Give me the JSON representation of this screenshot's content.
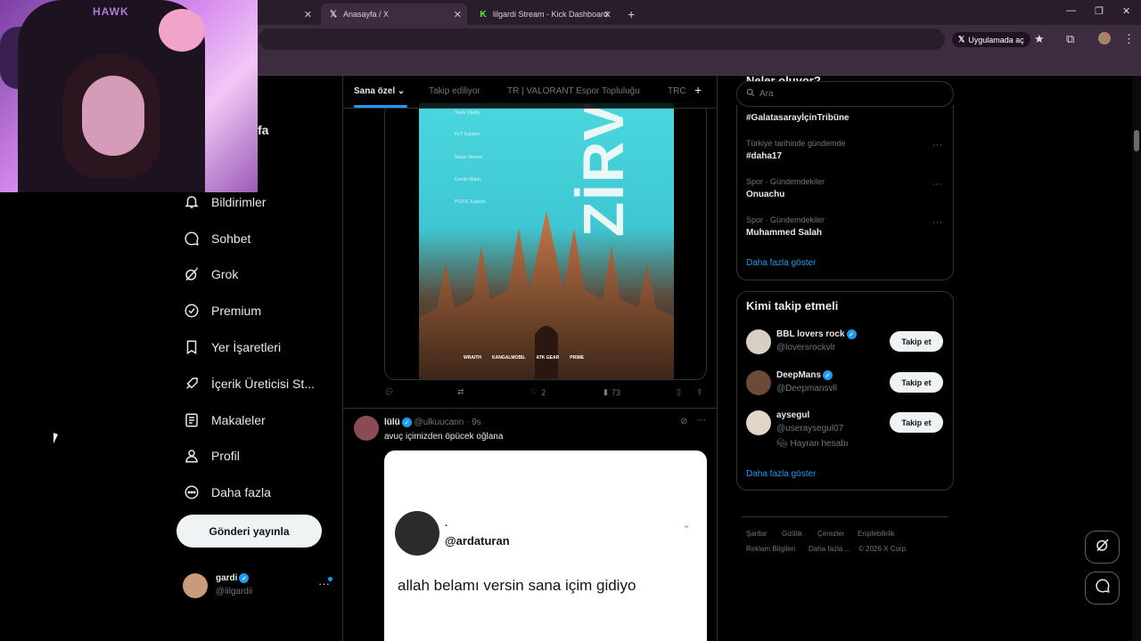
{
  "browser": {
    "tabs": [
      {
        "label": "",
        "icon": "blank-tab-icon"
      },
      {
        "label": "Anasayfa / X",
        "icon": "x-logo-icon"
      },
      {
        "label": "lilgardi Stream - Kick Dashboard",
        "icon": "kick-logo-icon"
      }
    ],
    "open_in_app": "Uygulamada aç",
    "colors": {
      "chrome_bg": "#3d2c3f",
      "tabbar_bg": "#2a1d2b"
    }
  },
  "webcam": {
    "chair_text": "HAWK",
    "partial_nav_text": "fa"
  },
  "sidebar": {
    "items": [
      {
        "label": "Bildirimler",
        "icon": "bell-icon"
      },
      {
        "label": "Sohbet",
        "icon": "chat-bubble-icon"
      },
      {
        "label": "Grok",
        "icon": "grok-icon"
      },
      {
        "label": "Premium",
        "icon": "verified-badge-icon"
      },
      {
        "label": "Yer İşaretleri",
        "icon": "bookmark-icon"
      },
      {
        "label": "İçerik Üreticisi St...",
        "icon": "rocket-icon"
      },
      {
        "label": "Makaleler",
        "icon": "article-icon"
      },
      {
        "label": "Profil",
        "icon": "person-icon"
      },
      {
        "label": "Daha fazla",
        "icon": "more-circle-icon"
      }
    ],
    "post_button": "Gönderi yayınla",
    "account": {
      "name": "gardi",
      "handle": "@lilgardii"
    }
  },
  "feed": {
    "tabs": [
      "Sana özel",
      "Takip ediliyor",
      "TR | VALORANT Espor Topluluğu",
      "TRC"
    ],
    "poster": {
      "title": "ZİRVE",
      "teams": [
        "Team Vitality",
        "FUT Esports",
        "Natus Vincere",
        "Gentle Mates",
        "PCIFIC Esports"
      ],
      "sponsors": [
        "WRAITH",
        "KANGALMOBIL",
        "ATK GEAR",
        "PRIME"
      ]
    },
    "post1_actions": {
      "reply": "",
      "repost": "",
      "likes": "2",
      "views": "73"
    },
    "post2": {
      "name": "lülü",
      "handle": "@ulkuucann",
      "time": "9s",
      "text": "avuç içimizden öpücek oğlana",
      "quote": {
        "dot": ".",
        "handle": "@ardaturan",
        "text": "allah belamı versin sana içim gidiyo"
      }
    }
  },
  "right": {
    "search_placeholder": "Ara",
    "trends_header": "Neler oluyor?",
    "trends": [
      {
        "category": "",
        "name": "#GalatasarayİçinTribüne"
      },
      {
        "category": "Türkiye tarihinde gündemde",
        "name": "#daha17"
      },
      {
        "category": "Spor · Gündemdekiler",
        "name": "Onuachu"
      },
      {
        "category": "Spor · Gündemdekiler",
        "name": "Muhammed Salah"
      }
    ],
    "trends_more": "Daha fazla göster",
    "who_to_follow": {
      "title": "Kimi takip etmeli",
      "users": [
        {
          "name": "BBL lovers rock",
          "handle": "@loversrockvlr",
          "button": "Takip et",
          "note": ""
        },
        {
          "name": "DeepMans",
          "handle": "@Deepmansvll",
          "button": "Takip et",
          "note": ""
        },
        {
          "name": "aysegul",
          "handle": "@useraysegul07",
          "button": "Takip et",
          "note": "Hayran hesabı"
        }
      ],
      "more": "Daha fazla göster"
    },
    "footer": {
      "links_row1": [
        "Şartlar",
        "Gizlilik",
        "Çerezler",
        "Erişilebilirlik"
      ],
      "links_row2": [
        "Reklam Bilgileri",
        "Daha fazla ...",
        "© 2026 X Corp."
      ]
    }
  }
}
